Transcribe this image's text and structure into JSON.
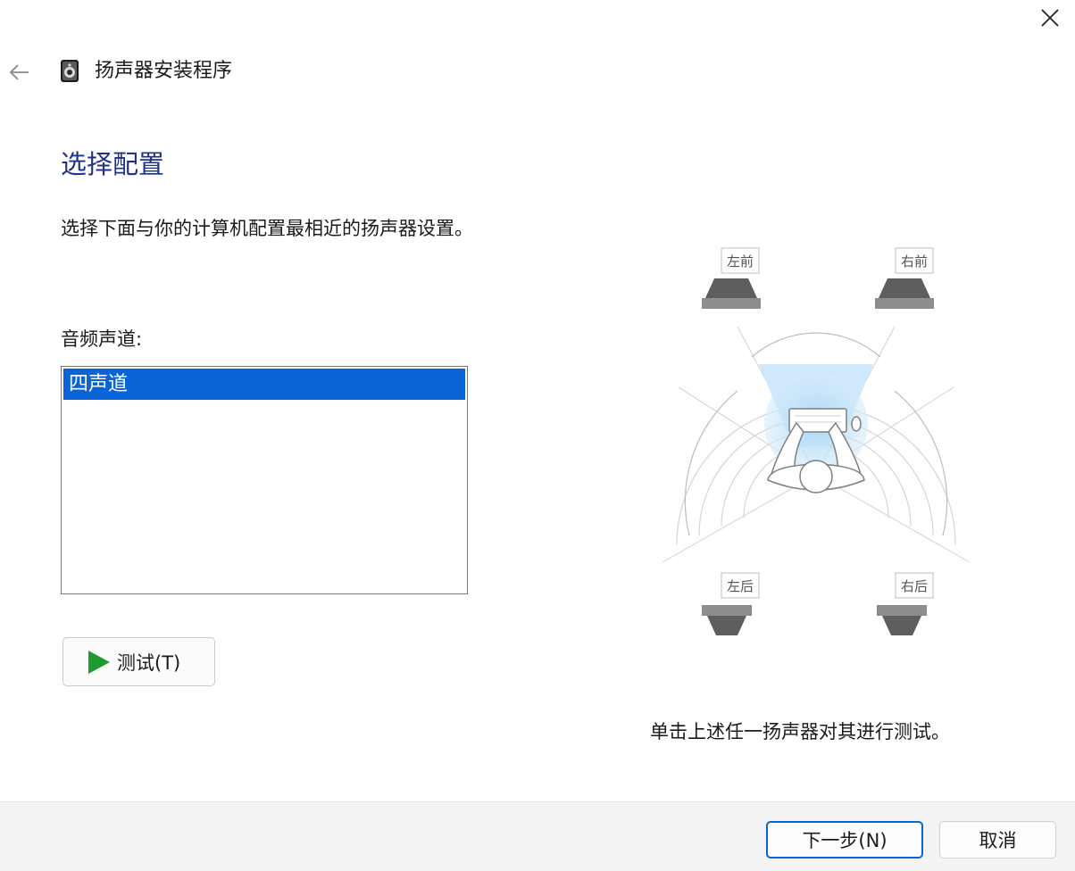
{
  "window": {
    "title": "扬声器安装程序",
    "close_icon": "close-icon",
    "back_icon": "back-arrow-icon",
    "app_icon": "speaker-app-icon"
  },
  "page": {
    "heading": "选择配置",
    "instruction": "选择下面与你的计算机配置最相近的扬声器设置。",
    "channels_label": "音频声道:"
  },
  "channels": {
    "items": [
      "四声道"
    ],
    "selected": "四声道"
  },
  "test_button": {
    "label": "测试(T)",
    "icon": "play-icon"
  },
  "diagram": {
    "speakers": {
      "front_left": "左前",
      "front_right": "右前",
      "rear_left": "左后",
      "rear_right": "右后"
    }
  },
  "hint": "单击上述任一扬声器对其进行测试。",
  "footer": {
    "next_label": "下一步(N)",
    "cancel_label": "取消"
  },
  "colors": {
    "heading": "#1e3287",
    "selection": "#0a64d6",
    "play": "#1f9a2e"
  }
}
